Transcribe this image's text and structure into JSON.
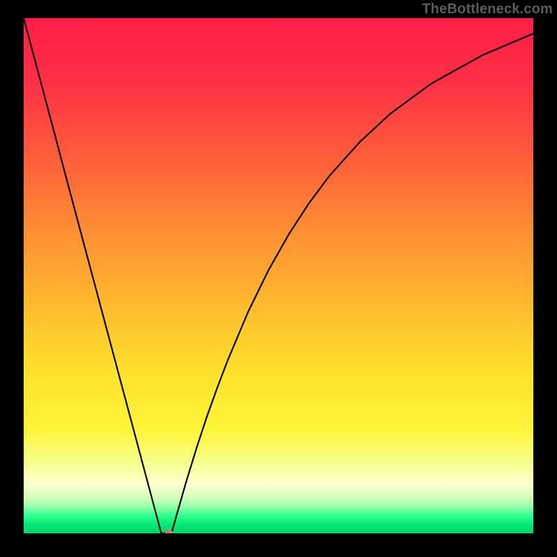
{
  "watermark": "TheBottleneck.com",
  "chart_data": {
    "type": "line",
    "title": "",
    "xlabel": "",
    "ylabel": "",
    "xlim": [
      0,
      100
    ],
    "ylim": [
      0,
      100
    ],
    "x": [
      0,
      2,
      4,
      6,
      8,
      10,
      12,
      14,
      16,
      18,
      20,
      22,
      24,
      26,
      27,
      28,
      29,
      30,
      32,
      34,
      36,
      38,
      40,
      44,
      48,
      52,
      56,
      60,
      66,
      72,
      80,
      90,
      100
    ],
    "values": [
      100,
      92.6,
      85.2,
      77.8,
      70.3,
      62.9,
      55.5,
      48.1,
      40.7,
      33.3,
      25.9,
      18.5,
      11.1,
      3.7,
      0,
      0,
      0,
      3.5,
      10.4,
      16.8,
      22.8,
      28.3,
      33.5,
      42.9,
      51.0,
      58.0,
      64.1,
      69.4,
      76.0,
      81.5,
      87.3,
      92.8,
      97.0
    ],
    "marker": {
      "x": 28.5,
      "y": 0
    },
    "background": {
      "stops": [
        {
          "pos": 0.0,
          "color": "#ff1d47"
        },
        {
          "pos": 0.12,
          "color": "#ff2f46"
        },
        {
          "pos": 0.26,
          "color": "#ff5a3c"
        },
        {
          "pos": 0.4,
          "color": "#ff8a34"
        },
        {
          "pos": 0.54,
          "color": "#ffb52e"
        },
        {
          "pos": 0.68,
          "color": "#ffdf2c"
        },
        {
          "pos": 0.8,
          "color": "#fff53a"
        },
        {
          "pos": 0.86,
          "color": "#f7ff88"
        },
        {
          "pos": 0.905,
          "color": "#fdffd1"
        },
        {
          "pos": 0.93,
          "color": "#d6ffba"
        },
        {
          "pos": 0.95,
          "color": "#8dffa5"
        },
        {
          "pos": 0.965,
          "color": "#33ff8e"
        },
        {
          "pos": 0.985,
          "color": "#00e676"
        },
        {
          "pos": 1.0,
          "color": "#00d66a"
        }
      ]
    },
    "curve_color": "#000000",
    "marker_color": "#c77a6e"
  }
}
